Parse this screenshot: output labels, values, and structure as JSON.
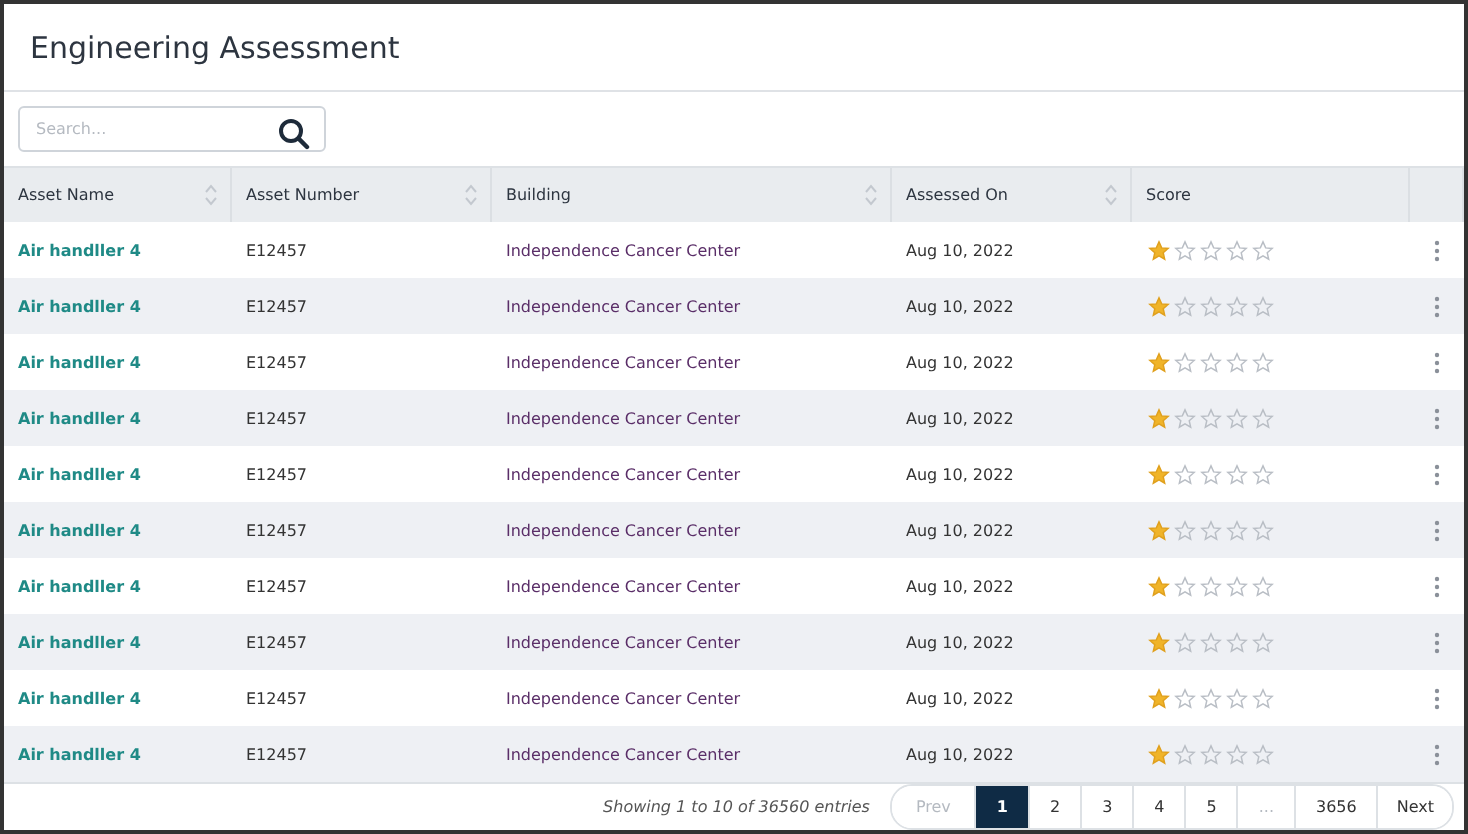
{
  "title": "Engineering Assessment",
  "search": {
    "placeholder": "Search..."
  },
  "table": {
    "columns": [
      {
        "label": "Asset Name",
        "sortable": true
      },
      {
        "label": "Asset Number",
        "sortable": true
      },
      {
        "label": "Building",
        "sortable": true
      },
      {
        "label": "Assessed On",
        "sortable": true
      },
      {
        "label": "Score",
        "sortable": false
      }
    ],
    "rows": [
      {
        "asset_name": "Air handller 4",
        "asset_number": "E12457",
        "building": "Independence Cancer Center",
        "assessed_on": "Aug 10, 2022",
        "stars": 1
      },
      {
        "asset_name": "Air handller 4",
        "asset_number": "E12457",
        "building": "Independence Cancer Center",
        "assessed_on": "Aug 10, 2022",
        "stars": 1
      },
      {
        "asset_name": "Air handller 4",
        "asset_number": "E12457",
        "building": "Independence Cancer Center",
        "assessed_on": "Aug 10, 2022",
        "stars": 1
      },
      {
        "asset_name": "Air handller 4",
        "asset_number": "E12457",
        "building": "Independence Cancer Center",
        "assessed_on": "Aug 10, 2022",
        "stars": 1
      },
      {
        "asset_name": "Air handller 4",
        "asset_number": "E12457",
        "building": "Independence Cancer Center",
        "assessed_on": "Aug 10, 2022",
        "stars": 1
      },
      {
        "asset_name": "Air handller 4",
        "asset_number": "E12457",
        "building": "Independence Cancer Center",
        "assessed_on": "Aug 10, 2022",
        "stars": 1
      },
      {
        "asset_name": "Air handller 4",
        "asset_number": "E12457",
        "building": "Independence Cancer Center",
        "assessed_on": "Aug 10, 2022",
        "stars": 1
      },
      {
        "asset_name": "Air handller 4",
        "asset_number": "E12457",
        "building": "Independence Cancer Center",
        "assessed_on": "Aug 10, 2022",
        "stars": 1
      },
      {
        "asset_name": "Air handller 4",
        "asset_number": "E12457",
        "building": "Independence Cancer Center",
        "assessed_on": "Aug 10, 2022",
        "stars": 1
      },
      {
        "asset_name": "Air handller 4",
        "asset_number": "E12457",
        "building": "Independence Cancer Center",
        "assessed_on": "Aug 10, 2022",
        "stars": 1
      }
    ]
  },
  "footer": {
    "summary": "Showing 1 to 10 of 36560 entries",
    "pagination": [
      {
        "label": "Prev",
        "kind": "nav",
        "disabled": true,
        "selected": false
      },
      {
        "label": "1",
        "kind": "page",
        "disabled": false,
        "selected": true
      },
      {
        "label": "2",
        "kind": "page",
        "disabled": false,
        "selected": false
      },
      {
        "label": "3",
        "kind": "page",
        "disabled": false,
        "selected": false
      },
      {
        "label": "4",
        "kind": "page",
        "disabled": false,
        "selected": false
      },
      {
        "label": "5",
        "kind": "page",
        "disabled": false,
        "selected": false
      },
      {
        "label": "...",
        "kind": "ellipsis",
        "disabled": true,
        "selected": false
      },
      {
        "label": "3656",
        "kind": "page",
        "disabled": false,
        "selected": false
      },
      {
        "label": "Next",
        "kind": "nav",
        "disabled": false,
        "selected": false
      }
    ]
  }
}
